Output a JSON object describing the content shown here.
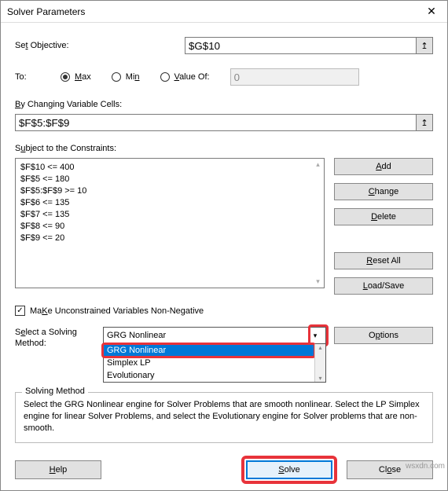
{
  "title": "Solver Parameters",
  "close_glyph": "✕",
  "labels": {
    "set_objective_pre": "Se",
    "set_objective_u": "t",
    "set_objective_post": " Objective:",
    "to": "To:",
    "max_u": "M",
    "max_post": "ax",
    "min_pre": "Mi",
    "min_u": "n",
    "valueof_u": "V",
    "valueof_post": "alue Of:",
    "changing_u": "B",
    "changing_post": "y Changing Variable Cells:",
    "subject_pre": "S",
    "subject_u": "u",
    "subject_post": "bject to the Constraints:",
    "unconstrained_u": "K",
    "unconstrained_pre": "Ma",
    "unconstrained_post": "e Unconstrained Variables Non-Negative",
    "select_method_pre": "S",
    "select_method_u": "e",
    "select_method_post": "lect a Solving Method:",
    "solving_method_legend": "Solving Method"
  },
  "objective": "$G$10",
  "to_selected": "max",
  "value_of": "0",
  "changing_cells": "$F$5:$F$9",
  "constraints": [
    "$F$10 <= 400",
    "$F$5 <= 180",
    "$F$5:$F$9 >= 10",
    "$F$6 <= 135",
    "$F$7 <= 135",
    "$F$8 <= 90",
    "$F$9 <= 20"
  ],
  "unconstrained_checked": true,
  "method_selected": "GRG Nonlinear",
  "method_options": [
    "GRG Nonlinear",
    "Simplex LP",
    "Evolutionary"
  ],
  "buttons": {
    "add_u": "A",
    "add_post": "dd",
    "change_u": "C",
    "change_post": "hange",
    "delete_u": "D",
    "delete_post": "elete",
    "reset_u": "R",
    "reset_post": "eset All",
    "loadsave_u": "L",
    "loadsave_post": "oad/Save",
    "options_pre": "O",
    "options_u": "p",
    "options_post": "tions",
    "help_u": "H",
    "help_post": "elp",
    "solve_u": "S",
    "solve_post": "olve",
    "close_pre": "Cl",
    "close_u": "o",
    "close_post": "se"
  },
  "description": "Select the GRG Nonlinear engine for Solver Problems that are smooth nonlinear. Select the LP Simplex engine for linear Solver Problems, and select the Evolutionary engine for Solver problems that are non-smooth.",
  "refedit_glyph": "↥",
  "check_glyph": "✓",
  "chevron": "▾",
  "up": "▴",
  "down": "▾",
  "watermark": "wsxdn.com"
}
